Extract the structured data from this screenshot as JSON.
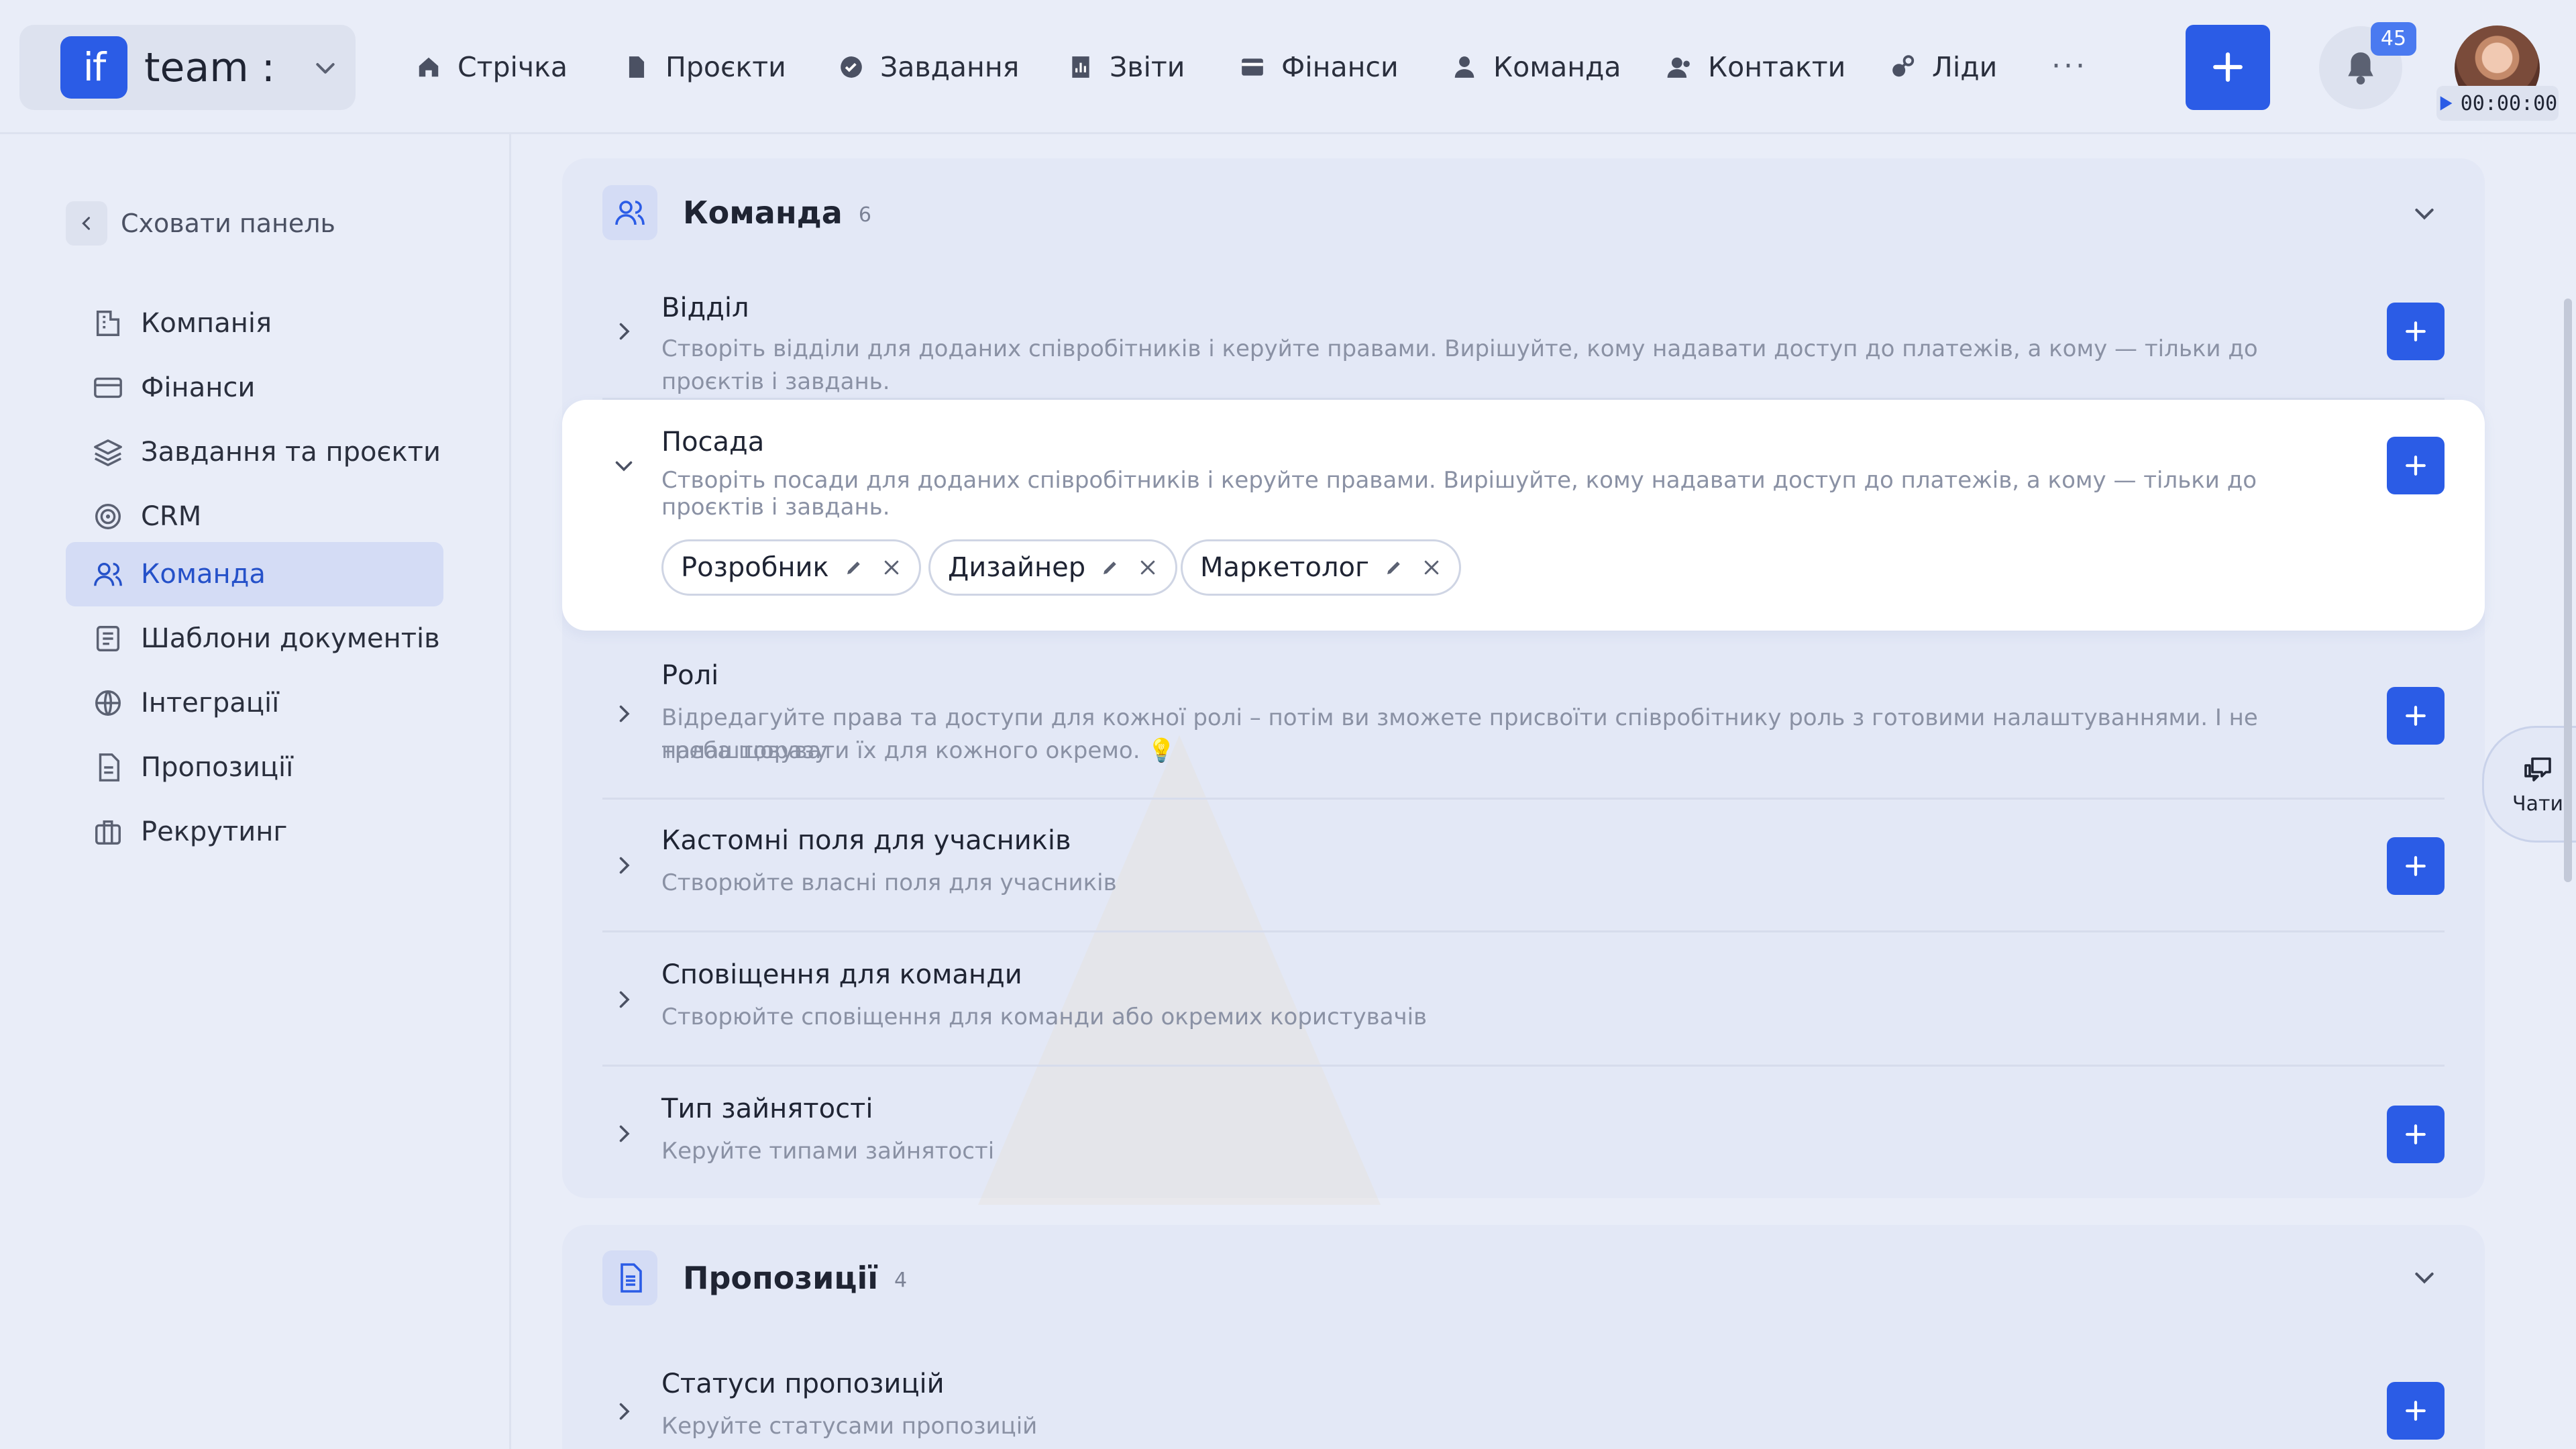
{
  "brand": {
    "logo_text": "if",
    "name": "team :"
  },
  "nav": [
    {
      "label": "Стрічка",
      "icon": "home-icon"
    },
    {
      "label": "Проєкти",
      "icon": "file-icon"
    },
    {
      "label": "Завдання",
      "icon": "check-circle-icon"
    },
    {
      "label": "Звіти",
      "icon": "report-icon"
    },
    {
      "label": "Фінанси",
      "icon": "wallet-icon"
    },
    {
      "label": "Команда",
      "icon": "person-icon"
    },
    {
      "label": "Контакти",
      "icon": "contacts-icon"
    },
    {
      "label": "Ліди",
      "icon": "leads-icon"
    }
  ],
  "nav_more": "···",
  "notifications": {
    "count": "45"
  },
  "timer": {
    "value": "00:00:00"
  },
  "sidebar": {
    "hide_label": "Сховати панель",
    "items": [
      {
        "label": "Компанія",
        "icon": "company-icon"
      },
      {
        "label": "Фінанси",
        "icon": "card-icon"
      },
      {
        "label": "Завдання та проєкти",
        "icon": "layers-icon"
      },
      {
        "label": "CRM",
        "icon": "target-icon"
      },
      {
        "label": "Команда",
        "icon": "team-icon",
        "active": true
      },
      {
        "label": "Шаблони документів",
        "icon": "template-icon"
      },
      {
        "label": "Інтеграції",
        "icon": "globe-icon"
      },
      {
        "label": "Пропозиції",
        "icon": "document-icon"
      },
      {
        "label": "Рекрутинг",
        "icon": "briefcase-icon"
      }
    ]
  },
  "team_card": {
    "title": "Команда",
    "count": "6",
    "rows": [
      {
        "title": "Відділ",
        "desc": "Створіть відділи для доданих співробітників і керуйте правами. Вирішуйте, кому надавати доступ до платежів, а кому — тільки до проєктів і завдань."
      },
      {
        "title": "Посада",
        "desc": "Створіть посади для доданих співробітників і керуйте правами. Вирішуйте, кому надавати доступ до платежів, а кому — тільки до проєктів і завдань.",
        "tags": [
          "Розробник",
          "Дизайнер",
          "Маркетолог"
        ]
      },
      {
        "title": "Ролі",
        "desc_line1": "Відредагуйте права та доступи для кожної ролі – потім ви зможете присвоїти співробітнику роль з готовими налаштуваннями. І не треба щоразу",
        "desc_line2": "налаштовувати їх для кожного окремо. 💡"
      },
      {
        "title": "Кастомні поля для учасників",
        "desc": "Створюйте власні поля для учасників"
      },
      {
        "title": "Сповіщення для команди",
        "desc": "Створюйте сповіщення для команди або окремих користувачів"
      },
      {
        "title": "Тип зайнятості",
        "desc": "Керуйте типами зайнятості"
      }
    ]
  },
  "proposals_card": {
    "title": "Пропозиції",
    "count": "4",
    "rows": [
      {
        "title": "Статуси пропозицій",
        "desc": "Керуйте статусами пропозицій"
      }
    ]
  },
  "chats": {
    "label": "Чати"
  },
  "colors": {
    "accent": "#2b5ce6",
    "active_bg": "#d4dcf5",
    "page_bg": "#e9edf8"
  }
}
